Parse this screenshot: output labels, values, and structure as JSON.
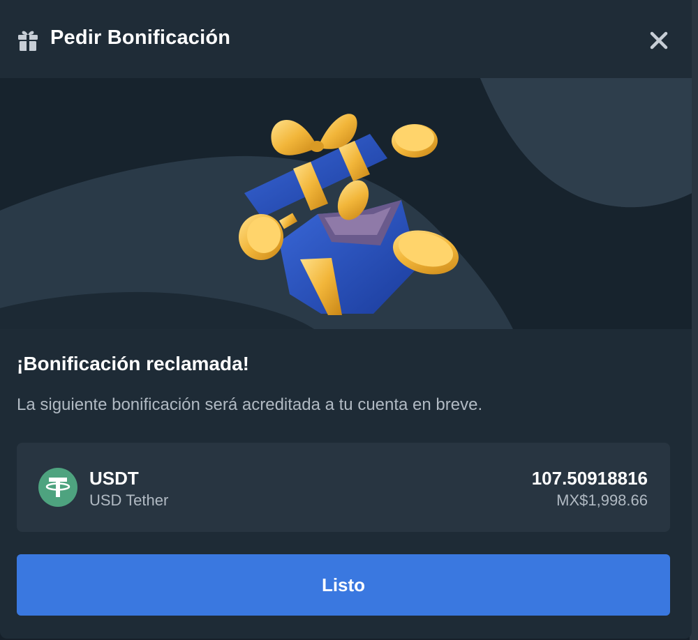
{
  "header": {
    "title": "Pedir Bonificación",
    "icon": "gift-icon",
    "close_icon": "close-icon"
  },
  "banner": {
    "illustration": "open-gift-box-with-coins"
  },
  "content": {
    "title": "¡Bonificación reclamada!",
    "description": "La siguiente bonificación será acreditada a tu cuenta en breve."
  },
  "asset": {
    "icon": "tether-icon",
    "symbol": "USDT",
    "name": "USD Tether",
    "amount": "107.50918816",
    "fiat_value": "MX$1,998.66"
  },
  "actions": {
    "done_label": "Listo"
  },
  "colors": {
    "modal_background": "#1e2b36",
    "card_background": "#283541",
    "primary_button": "#3a78e0",
    "tether_green": "#4ea37f",
    "muted_text": "#b1bac3"
  }
}
